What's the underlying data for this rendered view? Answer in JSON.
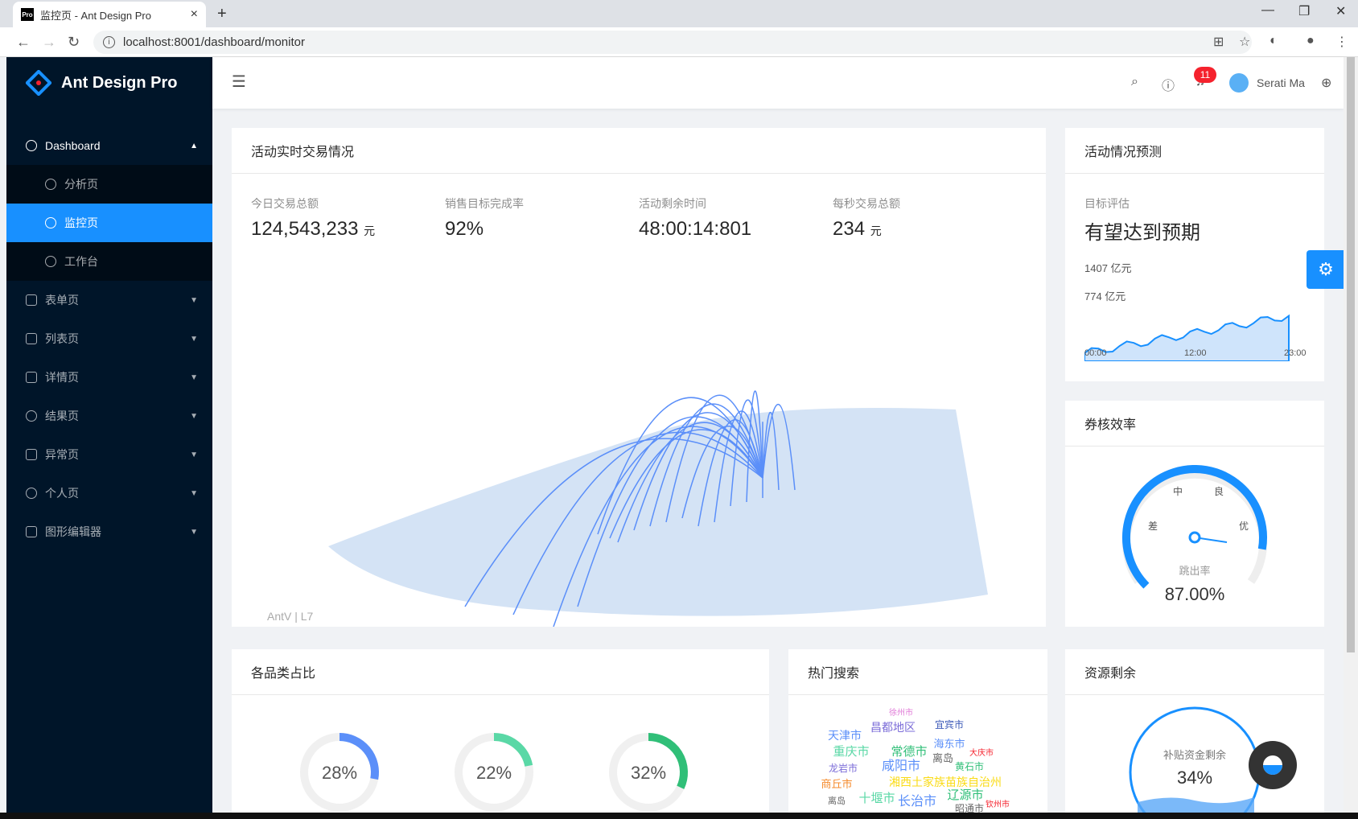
{
  "browser": {
    "tab_title": "监控页 - Ant Design Pro",
    "favicon": "Pro",
    "url": "localhost:8001/dashboard/monitor"
  },
  "sider": {
    "brand": "Ant Design Pro",
    "dashboard": "Dashboard",
    "items": [
      {
        "label": "分析页",
        "icon": "dashboard-icon"
      },
      {
        "label": "监控页",
        "icon": "smile-icon"
      },
      {
        "label": "工作台",
        "icon": "smile-icon"
      }
    ],
    "menus": [
      {
        "label": "表单页",
        "icon": "form-icon"
      },
      {
        "label": "列表页",
        "icon": "table-icon"
      },
      {
        "label": "详情页",
        "icon": "profile-icon"
      },
      {
        "label": "结果页",
        "icon": "check-circle-icon"
      },
      {
        "label": "异常页",
        "icon": "warning-icon"
      },
      {
        "label": "个人页",
        "icon": "user-icon"
      },
      {
        "label": "图形编辑器",
        "icon": "highlight-icon"
      }
    ]
  },
  "header": {
    "badge": "11",
    "user": "Serati Ma"
  },
  "realtime": {
    "title": "活动实时交易情况",
    "stats": [
      {
        "label": "今日交易总额",
        "value": "124,543,233",
        "unit": "元"
      },
      {
        "label": "销售目标完成率",
        "value": "92%",
        "unit": ""
      },
      {
        "label": "活动剩余时间",
        "value": "48:00:14:801",
        "unit": ""
      },
      {
        "label": "每秒交易总额",
        "value": "234",
        "unit": "元"
      }
    ],
    "map_credit": "AntV | L7"
  },
  "forecast": {
    "title": "活动情况预测",
    "sub": "目标评估",
    "headline": "有望达到预期",
    "y1": "1407 亿元",
    "y2": "774 亿元",
    "x": [
      "00:00",
      "12:00",
      "23:00"
    ]
  },
  "gauge": {
    "title": "券核效率",
    "labels": [
      "差",
      "中",
      "良",
      "优"
    ],
    "caption": "跳出率",
    "value": "87.00%",
    "percent": 87
  },
  "category": {
    "title": "各品类占比",
    "pies": [
      {
        "value": "28%",
        "percent": 28,
        "color": "#5b8ff9"
      },
      {
        "value": "22%",
        "percent": 22,
        "color": "#5ad8a6"
      },
      {
        "value": "32%",
        "percent": 32,
        "color": "#30bf78"
      }
    ]
  },
  "hot": {
    "title": "热门搜索",
    "words": [
      "徐州市",
      "昌都地区",
      "宜宾市",
      "天津市",
      "海东市",
      "重庆市",
      "常德市",
      "离岛",
      "大庆市",
      "龙岩市",
      "咸阳市",
      "黄石市",
      "商丘市",
      "湘西土家族苗族自治州",
      "离岛",
      "十堰市",
      "长治市",
      "辽源市",
      "钦州市",
      "昭通市"
    ]
  },
  "resource": {
    "title": "资源剩余",
    "caption": "补贴资金剩余",
    "value": "34%"
  }
}
